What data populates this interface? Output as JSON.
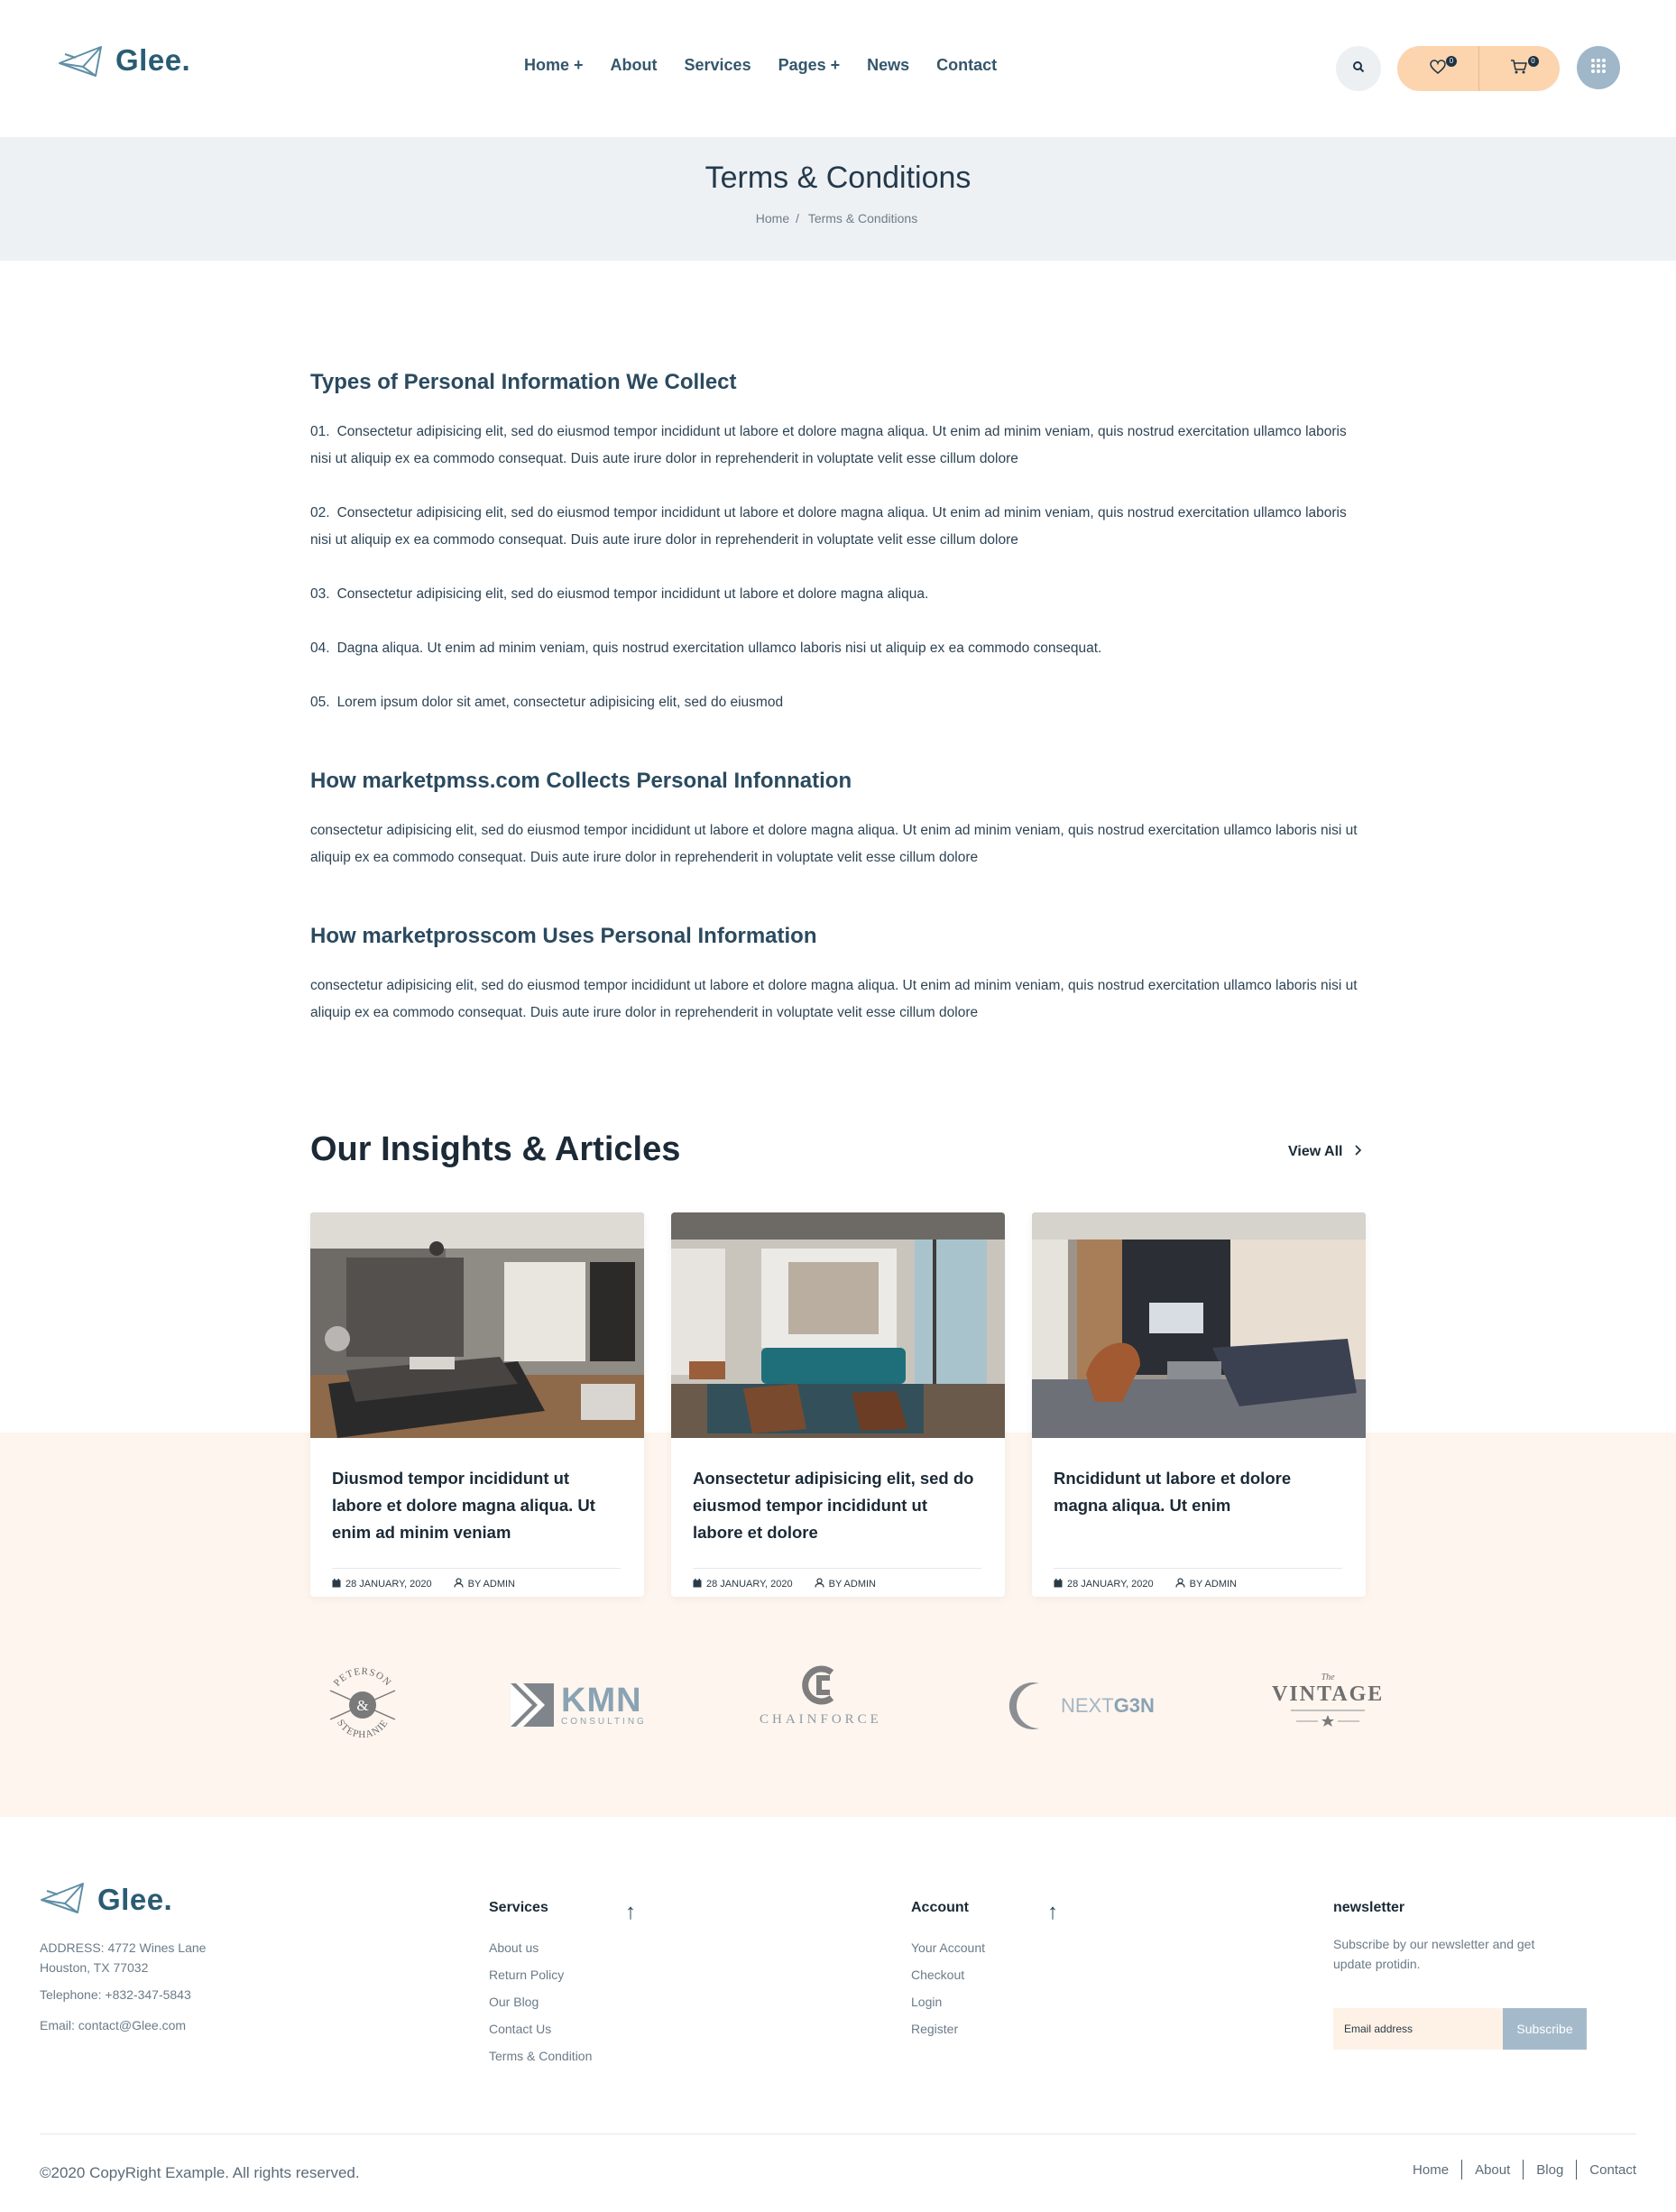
{
  "header": {
    "logo_text": "Glee.",
    "nav": [
      "Home +",
      "About",
      "Services",
      "Pages +",
      "News",
      "Contact"
    ],
    "wishlist_count": "0",
    "cart_count": "0"
  },
  "page": {
    "title": "Terms & Conditions",
    "breadcrumb_home": "Home",
    "breadcrumb_sep": "/",
    "breadcrumb_current": "Terms & Conditions"
  },
  "terms": {
    "section1": {
      "heading": "Types of Personal Information We Collect",
      "items": [
        {
          "num": "01.",
          "text": "Consectetur adipisicing elit, sed do eiusmod tempor incididunt ut labore et dolore magna aliqua. Ut enim ad minim veniam, quis nostrud exercitation ullamco laboris nisi ut aliquip ex ea commodo consequat. Duis aute irure dolor in reprehenderit in voluptate velit esse cillum dolore"
        },
        {
          "num": "02.",
          "text": "Consectetur adipisicing elit, sed do eiusmod tempor incididunt ut labore et dolore magna aliqua. Ut enim ad minim veniam, quis nostrud exercitation ullamco laboris nisi ut aliquip ex ea commodo consequat. Duis aute irure dolor in reprehenderit in voluptate velit esse cillum dolore"
        },
        {
          "num": "03.",
          "text": "Consectetur adipisicing elit, sed do eiusmod tempor incididunt ut labore et dolore magna aliqua."
        },
        {
          "num": "04.",
          "text": "Dagna aliqua. Ut enim ad minim veniam, quis nostrud exercitation ullamco laboris nisi ut aliquip ex ea commodo consequat."
        },
        {
          "num": "05.",
          "text": "Lorem ipsum dolor sit amet, consectetur adipisicing elit, sed do eiusmod"
        }
      ]
    },
    "section2": {
      "heading": "How marketpmss.com Collects Personal Infonnation",
      "text": "consectetur adipisicing elit, sed do eiusmod tempor incididunt ut labore et dolore magna aliqua. Ut enim ad minim veniam, quis nostrud exercitation ullamco laboris nisi ut aliquip ex ea commodo consequat. Duis aute irure dolor in reprehenderit in voluptate velit esse cillum dolore"
    },
    "section3": {
      "heading": "How marketprosscom Uses Personal Information",
      "text": "consectetur adipisicing elit, sed do eiusmod tempor incididunt ut labore et dolore magna aliqua. Ut enim ad minim veniam, quis nostrud exercitation ullamco laboris nisi ut aliquip ex ea commodo consequat. Duis aute irure dolor in reprehenderit in voluptate velit esse cillum dolore"
    }
  },
  "insights": {
    "title": "Our Insights & Articles",
    "view_all": "View All",
    "cards": [
      {
        "title": "Diusmod tempor incididunt ut labore et dolore magna aliqua. Ut enim ad minim veniam",
        "date": "28 JANUARY, 2020",
        "author": "BY ADMIN"
      },
      {
        "title": "Aonsectetur adipisicing elit, sed do eiusmod tempor incididunt ut labore et dolore",
        "date": "28 JANUARY, 2020",
        "author": "BY ADMIN"
      },
      {
        "title": "Rncididunt ut labore et dolore magna aliqua. Ut enim",
        "date": "28 JANUARY, 2020",
        "author": "BY ADMIN"
      }
    ]
  },
  "brands": {
    "peterson_top": "PETERSON",
    "peterson_mid": "&",
    "peterson_bottom": "STEPHANIE",
    "kmn": "KMN",
    "kmn_sub": "CONSULTING",
    "chainforce": "CHAINFORCE",
    "nextgen_a": "NEXT",
    "nextgen_b": "G3N",
    "vintage_the": "The",
    "vintage": "VINTAGE"
  },
  "footer": {
    "logo_text": "Glee.",
    "address_line1": "ADDRESS: 4772 Wines Lane",
    "address_line2": "Houston, TX 77032",
    "telephone": "Telephone: +832-347-5843",
    "email": "Email: contact@Glee.com",
    "services_heading": "Services",
    "services": [
      "About us",
      "Return Policy",
      "Our Blog",
      "Contact Us",
      "Terms & Condition"
    ],
    "account_heading": "Account",
    "account": [
      "Your Account",
      "Checkout",
      "Login",
      "Register"
    ],
    "newsletter_heading": "newsletter",
    "newsletter_text": "Subscribe by our newsletter and get update protidin.",
    "email_placeholder": "Email address",
    "subscribe_label": "Subscribe",
    "copyright": "©2020 CopyRight Example. All rights reserved.",
    "bottom_nav": [
      "Home",
      "About",
      "Blog",
      "Contact"
    ]
  },
  "colors": {
    "brand": "#2a5c74",
    "accent_peach": "#fcd4ae",
    "band_gray": "#eef1f4",
    "band_peach": "#fef5ee",
    "button_blue": "#a4bacb"
  }
}
